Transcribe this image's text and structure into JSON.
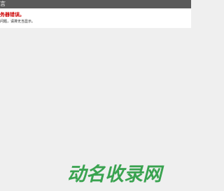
{
  "header": {
    "title": "言"
  },
  "error": {
    "title": "务器错误。",
    "description": "问题，请排无当显示。"
  },
  "watermark": {
    "text": "动名收录网",
    "color": "#2f9e47"
  }
}
